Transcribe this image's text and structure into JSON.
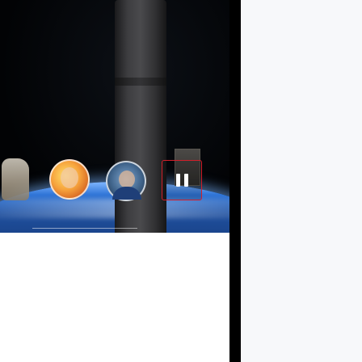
{
  "player": {
    "pause_button_label": "Pause",
    "avatars": [
      {
        "name": "avatar-1"
      },
      {
        "name": "avatar-2"
      }
    ]
  },
  "colors": {
    "pause_border": "#d31f2a",
    "background": "#f7f8fa"
  }
}
